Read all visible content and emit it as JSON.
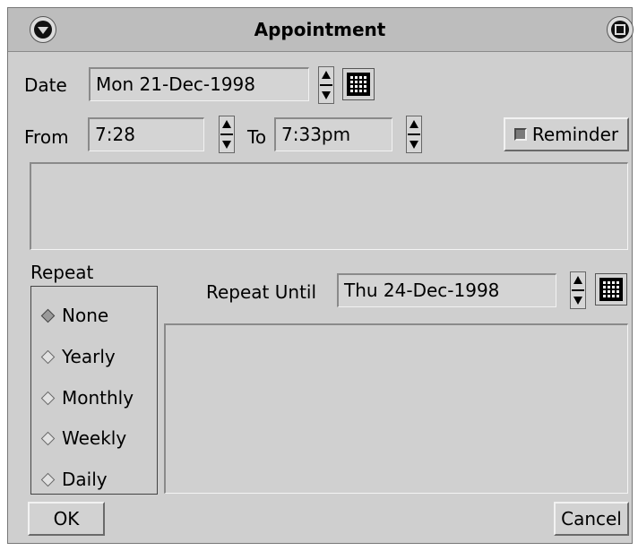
{
  "window": {
    "title": "Appointment"
  },
  "date": {
    "label": "Date",
    "value": "Mon  21-Dec-1998"
  },
  "time": {
    "from_label": "From",
    "from_value": "7:28",
    "to_label": "To",
    "to_value": "7:33pm"
  },
  "reminder": {
    "label": "Reminder"
  },
  "description": {
    "value": ""
  },
  "repeat": {
    "label": "Repeat",
    "options": [
      {
        "label": "None"
      },
      {
        "label": "Yearly"
      },
      {
        "label": "Monthly"
      },
      {
        "label": "Weekly"
      },
      {
        "label": "Daily"
      }
    ],
    "selected": "None",
    "until_label": "Repeat Until",
    "until_value": "Thu  24-Dec-1998"
  },
  "buttons": {
    "ok": "OK",
    "cancel": "Cancel"
  }
}
